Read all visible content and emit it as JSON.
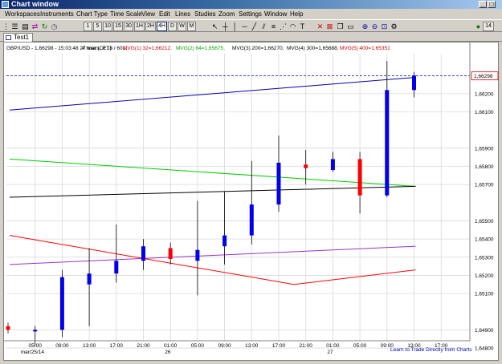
{
  "window": {
    "title": "Chart window"
  },
  "menu": [
    "Workspaces",
    "Instruments",
    "Chart Type",
    "Time Scale",
    "View",
    "Edit",
    "Lines",
    "Studies",
    "Zoom",
    "Settings",
    "Window",
    "Help"
  ],
  "toolbar": {
    "timeframes": [
      "1",
      "5",
      "10",
      "15",
      "30",
      "1H",
      "2H",
      "4H",
      "D",
      "W",
      "M"
    ],
    "active_timeframe": "4H",
    "right_label": "14"
  },
  "tab": {
    "label": "Test1"
  },
  "chart": {
    "header": {
      "instrument": "GBP/USD - 1,66298 - 15:03:48  27 mar (CET)",
      "interval": "4 hours, # 18 / 601,",
      "ma1": "MVG(1) 32=1,66212,",
      "ma2": "MVG(2) 64=1,65675,",
      "ma3": "MVG(3) 200=1,66270,",
      "ma4": "MVG(4) 300=1,65688,",
      "ma5": "MVG(5) 400=1,65351"
    },
    "current_price_label": "1,66298",
    "footer_link": "Learn to Trade Directly from Charts"
  },
  "chart_data": {
    "type": "candlestick",
    "instrument": "GBP/USD",
    "interval": "4 hours",
    "ylim": [
      1.6484,
      1.6642
    ],
    "y_ticks": [
      "1,66200",
      "1,66100",
      "1,65900",
      "1,65800",
      "1,65700",
      "1,65500",
      "1,65400",
      "1,65300",
      "1,65200",
      "1,65100",
      "1,64900",
      "1,64800"
    ],
    "x_hour_ticks": [
      "05:00",
      "09:00",
      "13:00",
      "17:00",
      "21:00",
      "01:00",
      "05:00",
      "09:00",
      "13:00",
      "17:00",
      "21:00",
      "01:00",
      "05:00",
      "09:00",
      "13:00",
      "17:00"
    ],
    "x_date_labels": [
      "mar/25/14",
      "26",
      "27"
    ],
    "current_price": 1.66298,
    "candles": [
      {
        "time": "mar/25 01:00",
        "open": 1.6492,
        "high": 1.6494,
        "low": 1.6488,
        "close": 1.649
      },
      {
        "time": "mar/25 05:00",
        "open": 1.649,
        "high": 1.6492,
        "low": 1.6481,
        "close": 1.649
      },
      {
        "time": "mar/25 09:00",
        "open": 1.649,
        "high": 1.6523,
        "low": 1.6486,
        "close": 1.6519
      },
      {
        "time": "mar/25 13:00",
        "open": 1.6515,
        "high": 1.6535,
        "low": 1.6492,
        "close": 1.6521
      },
      {
        "time": "mar/25 17:00",
        "open": 1.6521,
        "high": 1.6548,
        "low": 1.6516,
        "close": 1.6528
      },
      {
        "time": "mar/25 21:00",
        "open": 1.6528,
        "high": 1.654,
        "low": 1.6523,
        "close": 1.6536
      },
      {
        "time": "mar/26 01:00",
        "open": 1.6535,
        "high": 1.6538,
        "low": 1.6526,
        "close": 1.6529
      },
      {
        "time": "mar/26 05:00",
        "open": 1.6528,
        "high": 1.6561,
        "low": 1.6509,
        "close": 1.6534
      },
      {
        "time": "mar/26 09:00",
        "open": 1.6536,
        "high": 1.6566,
        "low": 1.6526,
        "close": 1.6542
      },
      {
        "time": "mar/26 13:00",
        "open": 1.6542,
        "high": 1.6583,
        "low": 1.6537,
        "close": 1.6559
      },
      {
        "time": "mar/26 17:00",
        "open": 1.6559,
        "high": 1.6597,
        "low": 1.6555,
        "close": 1.6582
      },
      {
        "time": "mar/26 21:00",
        "open": 1.6581,
        "high": 1.6589,
        "low": 1.657,
        "close": 1.6579
      },
      {
        "time": "mar/27 01:00",
        "open": 1.6578,
        "high": 1.6588,
        "low": 1.6577,
        "close": 1.6584
      },
      {
        "time": "mar/27 05:00",
        "open": 1.6584,
        "high": 1.6588,
        "low": 1.6554,
        "close": 1.6564
      },
      {
        "time": "mar/27 09:00",
        "open": 1.6564,
        "high": 1.6638,
        "low": 1.6563,
        "close": 1.6622
      },
      {
        "time": "mar/27 13:00",
        "open": 1.6622,
        "high": 1.6632,
        "low": 1.6618,
        "close": 1.663
      }
    ],
    "moving_averages": [
      {
        "name": "MVG(1) 32",
        "color": "#0000aa",
        "start": 1.6611,
        "end": 1.6629
      },
      {
        "name": "MVG(2) 64",
        "color": "#00cc00",
        "start": 1.6584,
        "end": 1.6569
      },
      {
        "name": "MVG(3) 200",
        "color": "#000000",
        "start": 1.6563,
        "end": 1.6569
      },
      {
        "name": "MVG(4) 300",
        "color": "#9933cc",
        "start": 1.6526,
        "end": 1.6536
      },
      {
        "name": "MVG(5) 400",
        "color": "#ff0000",
        "start": 1.6542,
        "end": 1.6523,
        "min": 1.6515
      }
    ],
    "colors": {
      "bull": "#0000ee",
      "bear": "#ff0000",
      "grid": "#d8d8d8",
      "price_line": "#0000aa"
    }
  }
}
